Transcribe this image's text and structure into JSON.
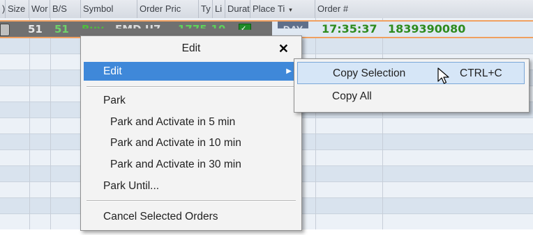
{
  "grid": {
    "columns": [
      {
        "label": ")",
        "w": 8
      },
      {
        "label": "Size",
        "w": 34
      },
      {
        "label": "Wor",
        "w": 30
      },
      {
        "label": "B/S",
        "w": 44
      },
      {
        "label": "Symbol",
        "w": 81
      },
      {
        "label": "Order Pric",
        "w": 88
      },
      {
        "label": "Ty",
        "w": 20
      },
      {
        "label": "Li",
        "w": 18
      },
      {
        "label": "Durati",
        "w": 36
      },
      {
        "label": "Place Ti",
        "w": 93
      },
      {
        "label": "Order #",
        "w": 180
      }
    ],
    "sort_arrow": "▾",
    "selected_row": {
      "size": "51",
      "working": "51",
      "side": "Buy",
      "symbol": "EMD U7",
      "price": "1775.10",
      "duration": "DAY",
      "place_time": "17:35:37",
      "order_number": "1839390080"
    },
    "colors": {
      "accent": "#f0a060",
      "highlight": "#3f88d9",
      "green": "#2e8b1e"
    }
  },
  "context_menu": {
    "title": "Edit",
    "close_icon": "close-icon",
    "items": [
      {
        "label": "Edit",
        "has_submenu": true
      },
      {
        "label": "Park"
      },
      {
        "label": "Park and Activate in 5 min"
      },
      {
        "label": "Park and Activate in 10 min"
      },
      {
        "label": "Park and Activate in 30 min"
      },
      {
        "label": "Park Until..."
      },
      {
        "label": "Cancel Selected Orders"
      }
    ],
    "submenu_arrow": "▶"
  },
  "submenu": {
    "items": [
      {
        "label": "Copy Selection",
        "shortcut": "CTRL+C"
      },
      {
        "label": "Copy All"
      }
    ]
  }
}
